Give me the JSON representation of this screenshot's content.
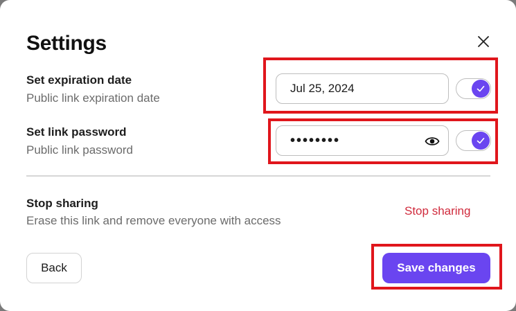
{
  "dialog": {
    "title": "Settings",
    "close_icon": "close-icon"
  },
  "expiration": {
    "label": "Set expiration date",
    "description": "Public link expiration date",
    "value": "Jul 25, 2024",
    "toggle_on": true
  },
  "password": {
    "label": "Set link password",
    "description": "Public link password",
    "masked_value": "••••••••",
    "eye_icon": "eye-icon",
    "toggle_on": true
  },
  "stop_sharing": {
    "label": "Stop sharing",
    "description": "Erase this link and remove everyone with access",
    "link_label": "Stop sharing"
  },
  "footer": {
    "back_label": "Back",
    "save_label": "Save changes"
  },
  "colors": {
    "accent": "#6a45f0",
    "danger": "#d02a3c",
    "highlight": "#e0161c"
  }
}
